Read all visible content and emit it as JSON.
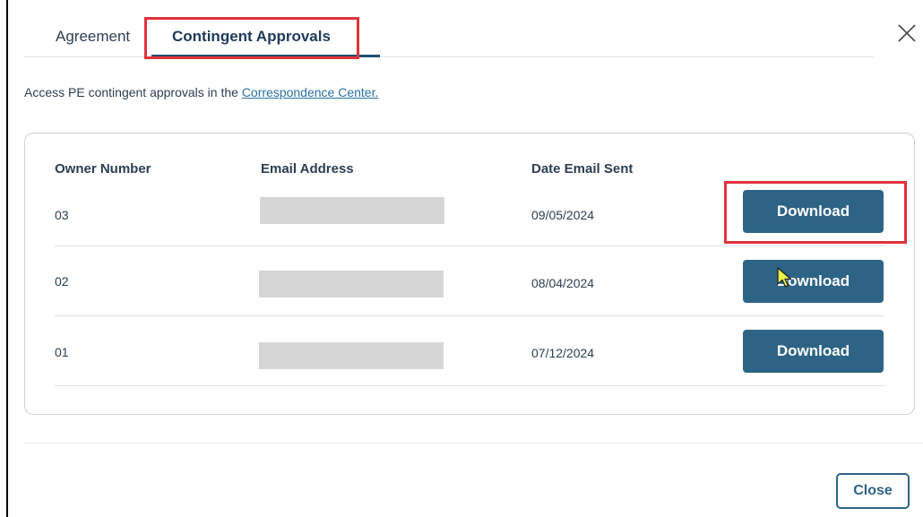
{
  "tabs": [
    {
      "label": "Agreement"
    },
    {
      "label": "Contingent Approvals",
      "active": true
    }
  ],
  "intro": {
    "text": "Access PE contingent approvals in the ",
    "link": "Correspondence Center."
  },
  "table": {
    "headers": {
      "owner": "Owner Number",
      "email": "Email Address",
      "date": "Date Email Sent"
    },
    "rows": [
      {
        "owner": "03",
        "email": "",
        "date": "09/05/2024",
        "action": "Download"
      },
      {
        "owner": "02",
        "email": "",
        "date": "08/04/2024",
        "action": "Download"
      },
      {
        "owner": "01",
        "email": "",
        "date": "07/12/2024",
        "action": "Download"
      }
    ]
  },
  "footer": {
    "close_label": "Close"
  },
  "colors": {
    "primary": "#2d6485",
    "highlight": "#e0323a",
    "redaction": "#d6d6d6"
  },
  "icons": {
    "close": "close-icon",
    "cursor": "mouse-pointer-icon"
  }
}
